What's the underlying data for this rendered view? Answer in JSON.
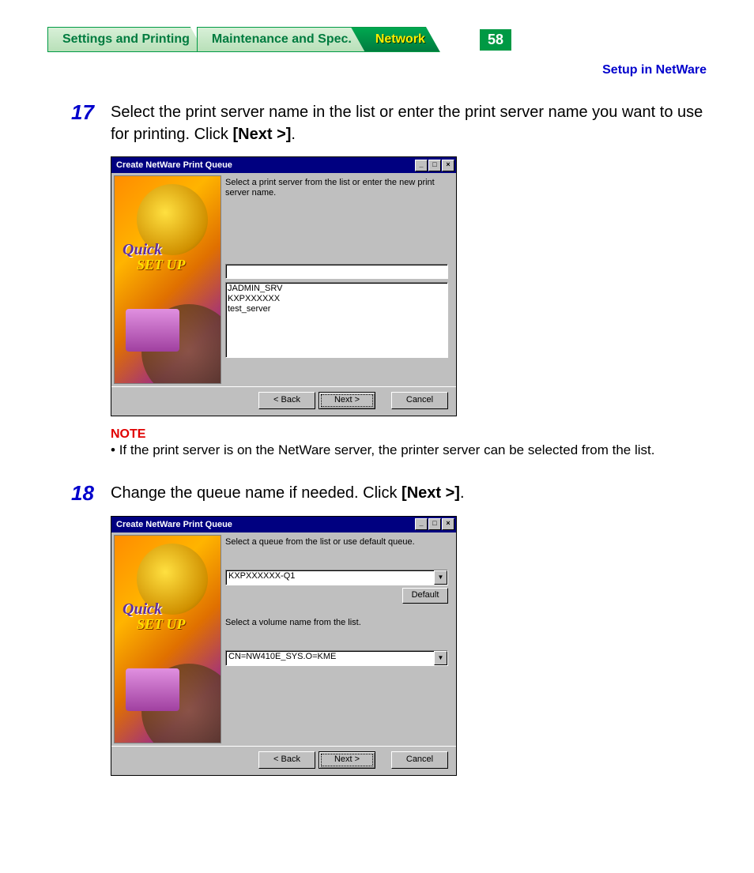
{
  "nav": {
    "tabs": [
      "Settings and Printing",
      "Maintenance and Spec.",
      "Network"
    ],
    "page_number": "58",
    "section_title": "Setup in NetWare"
  },
  "steps": {
    "s17": {
      "num": "17",
      "text_a": "Select the print server name in the list or enter the print server name you want to use for printing. Click ",
      "bold": "[Next >]",
      "text_b": "."
    },
    "s18": {
      "num": "18",
      "text_a": "Change the queue name if needed. Click ",
      "bold": "[Next >]",
      "text_b": "."
    }
  },
  "note": {
    "label": "NOTE",
    "text": "If the print server is on the NetWare server, the printer server can be selected from the list."
  },
  "dialog1": {
    "title": "Create NetWare Print Queue",
    "side_label1": "Quick",
    "side_label2": "SET UP",
    "prompt": "Select a print server from the list or enter the new print server name.",
    "input_value": "",
    "list_items": [
      "JADMIN_SRV",
      "KXPXXXXXX",
      "test_server"
    ],
    "buttons": {
      "back": "< Back",
      "next": "Next >",
      "cancel": "Cancel"
    }
  },
  "dialog2": {
    "title": "Create NetWare Print Queue",
    "side_label1": "Quick",
    "side_label2": "SET UP",
    "prompt1": "Select a queue from the list or use default queue.",
    "queue_value": "KXPXXXXXX-Q1",
    "default_btn": "Default",
    "prompt2": "Select a volume name from the list.",
    "volume_value": "CN=NW410E_SYS.O=KME",
    "buttons": {
      "back": "< Back",
      "next": "Next >",
      "cancel": "Cancel"
    }
  }
}
